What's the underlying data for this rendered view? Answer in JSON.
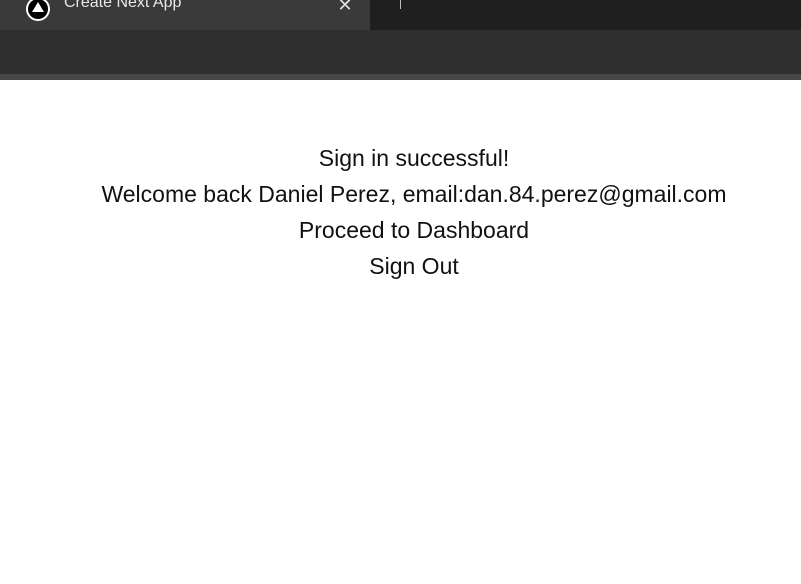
{
  "browser": {
    "tab": {
      "title": "Create Next App",
      "close_glyph": "✕",
      "favicon": "nextjs-logo-icon"
    },
    "colors": {
      "tabstrip": "#1f1f1f",
      "active_tab": "#3a3a3a",
      "toolbar": "#2f2f2f"
    }
  },
  "page": {
    "status_message": "Sign in successful!",
    "welcome_message": "Welcome back Daniel Perez, email:dan.84.perez@gmail.com",
    "dashboard_link": "Proceed to Dashboard",
    "sign_out_link": "Sign Out"
  }
}
